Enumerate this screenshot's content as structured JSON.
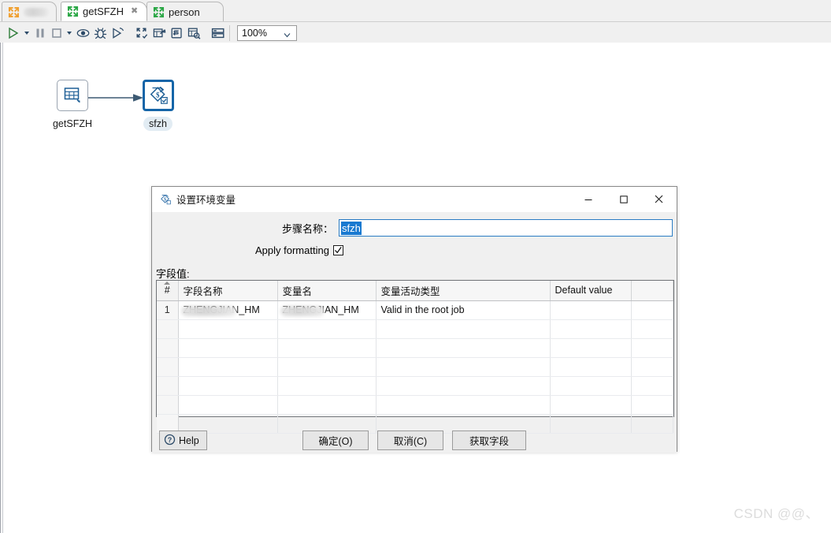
{
  "tabs": [
    {
      "label": "",
      "icon": "transformation-orange-icon",
      "active": false,
      "blurred": true,
      "closable": false
    },
    {
      "label": "getSFZH",
      "icon": "transformation-green-icon",
      "active": true,
      "blurred": false,
      "closable": true
    },
    {
      "label": "person",
      "icon": "transformation-green-icon",
      "active": false,
      "blurred": false,
      "closable": false
    }
  ],
  "toolbar": {
    "buttons": [
      {
        "name": "run-icon",
        "title": "Run"
      },
      {
        "name": "run-dropdown-caret-icon",
        "title": "Run options"
      },
      {
        "name": "pause-icon",
        "title": "Pause"
      },
      {
        "name": "stop-icon",
        "title": "Stop"
      },
      {
        "name": "stop-dropdown-caret-icon",
        "title": "Stop options"
      },
      {
        "name": "preview-eye-icon",
        "title": "Preview"
      },
      {
        "name": "debug-bug-icon",
        "title": "Debug"
      },
      {
        "name": "replay-icon",
        "title": "Replay"
      },
      {
        "name": "verify-transformation-icon",
        "title": "Verify"
      },
      {
        "name": "analyze-impact-icon",
        "title": "Impact analysis"
      },
      {
        "name": "sql-icon",
        "title": "Get SQL"
      },
      {
        "name": "show-results-icon",
        "title": "Show results"
      },
      {
        "name": "grid-layout-icon",
        "title": "Arrange"
      }
    ],
    "zoom": {
      "value": "100%",
      "caret": "chevron-down-icon"
    }
  },
  "canvas": {
    "nodes": [
      {
        "id": "getSFZH",
        "label": "getSFZH",
        "icon": "table-input-icon"
      },
      {
        "id": "sfzh",
        "label": "sfzh",
        "icon": "set-variable-icon",
        "selected": true
      }
    ],
    "hop": {
      "from": "getSFZH",
      "to": "sfzh",
      "icon": "arrow-right-icon"
    }
  },
  "dialog": {
    "icon": "set-variable-icon",
    "title": "设置环境变量",
    "window_buttons": [
      {
        "name": "minimize-icon",
        "label": "—"
      },
      {
        "name": "maximize-icon",
        "label": "□"
      },
      {
        "name": "close-icon",
        "label": "✕"
      }
    ],
    "step_name": {
      "label": "步骤名称：",
      "value": "sfzh",
      "selected": true
    },
    "apply_formatting": {
      "label": "Apply formatting",
      "checked": true
    },
    "field_values_label": "字段值:",
    "table": {
      "columns": [
        "#",
        "字段名称",
        "变量名",
        "变量活动类型",
        "Default value",
        ""
      ],
      "rows": [
        {
          "num": "1",
          "field_name": "ZHENGJIAN_HM",
          "variable_name": "ZHENGJIAN_HM",
          "variable_scope": "Valid in the root job",
          "default_value": "",
          "extra": "",
          "redacted": true
        }
      ],
      "empty_row_count": 6
    },
    "buttons": {
      "help": {
        "label": "Help",
        "icon": "help-question-icon"
      },
      "ok": {
        "label": "确定(O)",
        "mnemonic": "O"
      },
      "cancel": {
        "label": "取消(C)",
        "mnemonic": "C"
      },
      "get_fields": {
        "label": "获取字段"
      }
    }
  },
  "watermark": "CSDN @@、",
  "colors": {
    "accent_blue": "#1565a8",
    "selection_blue": "#1879d0",
    "tab_green": "#2aa745",
    "tab_orange": "#f0a030",
    "toolbar_icon": "#2c4a68",
    "dialog_bg": "#f0f0f0"
  }
}
